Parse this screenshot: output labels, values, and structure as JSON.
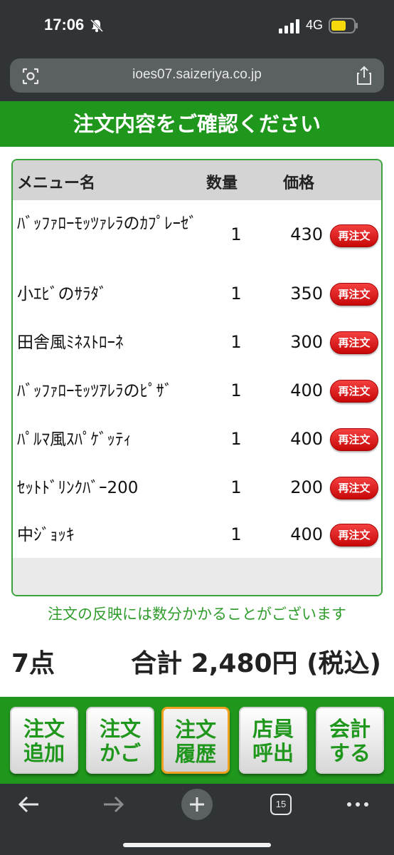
{
  "status": {
    "time": "17:06",
    "network": "4G"
  },
  "browser": {
    "url": "ioes07.saizeriya.co.jp",
    "tab_count": "15"
  },
  "page": {
    "title": "注文内容をご確認ください"
  },
  "table": {
    "headers": {
      "name": "メニュー名",
      "qty": "数量",
      "price": "価格"
    },
    "reorder_label": "再注文",
    "rows": [
      {
        "name": "ﾊﾞｯﾌｧﾛｰﾓｯﾂｧﾚﾗのｶﾌﾟﾚｰｾﾞ",
        "qty": "1",
        "price": "430"
      },
      {
        "name": "小ｴﾋﾞのｻﾗﾀﾞ",
        "qty": "1",
        "price": "350"
      },
      {
        "name": "田舎風ﾐﾈｽﾄﾛｰﾈ",
        "qty": "1",
        "price": "300"
      },
      {
        "name": "ﾊﾞｯﾌｧﾛｰﾓｯﾂｱﾚﾗのﾋﾟｻﾞ",
        "qty": "1",
        "price": "400"
      },
      {
        "name": "ﾊﾟﾙﾏ風ｽﾊﾟｹﾞｯﾃｨ",
        "qty": "1",
        "price": "400"
      },
      {
        "name": "ｾｯﾄﾄﾞﾘﾝｸﾊﾞｰ200",
        "qty": "1",
        "price": "200"
      },
      {
        "name": "中ｼﾞｮｯｷ",
        "qty": "1",
        "price": "400"
      }
    ]
  },
  "notice": "注文の反映には数分かかることがございます",
  "summary": {
    "count": "7点",
    "total": "合計 2,480円 (税込)"
  },
  "nav": [
    {
      "line1": "注文",
      "line2": "追加"
    },
    {
      "line1": "注文",
      "line2": "かご"
    },
    {
      "line1": "注文",
      "line2": "履歴"
    },
    {
      "line1": "店員",
      "line2": "呼出"
    },
    {
      "line1": "会計",
      "line2": "する"
    }
  ],
  "colors": {
    "brand_green": "#1f961c",
    "reorder_red": "#d81010",
    "active_border": "#f0a020"
  }
}
